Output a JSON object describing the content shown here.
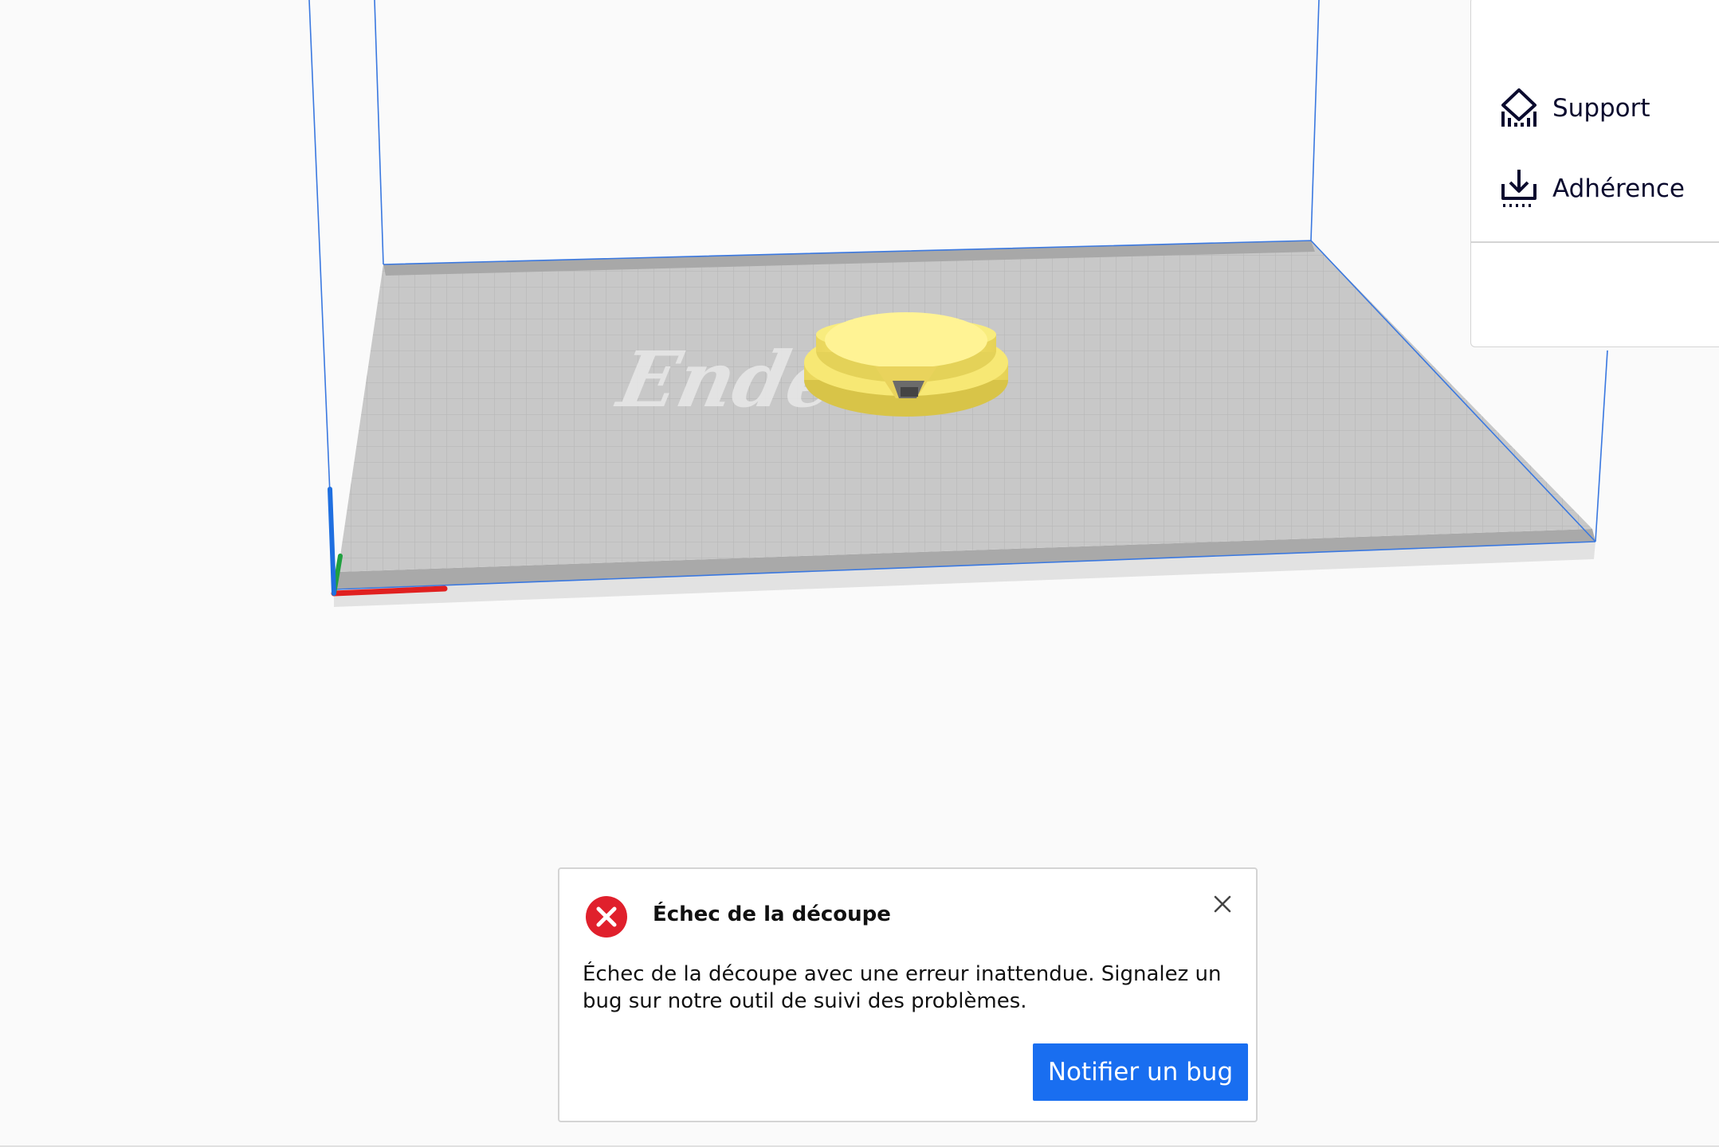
{
  "settings_panel": {
    "items": [
      {
        "label": "Support",
        "icon": "support-icon"
      },
      {
        "label": "Adhérence",
        "icon": "adhesion-icon"
      }
    ]
  },
  "viewport": {
    "bed_logo_text": "Ender",
    "model_color": "#f4e36b",
    "bed_color": "#c8c8c8",
    "axis_colors": {
      "x": "#e02020",
      "y": "#20a040",
      "z": "#1f6fe0"
    },
    "volume_line_color": "#3a78e0"
  },
  "message": {
    "title": "Échec de la découpe",
    "body": "Échec de la découpe avec une erreur inattendue. Signalez un bug sur notre outil de suivi des problèmes.",
    "action_label": "Notifier un bug",
    "icon": "error-icon",
    "close_icon": "close-icon",
    "accent": "#196ef0",
    "error_color": "#e0202c"
  }
}
